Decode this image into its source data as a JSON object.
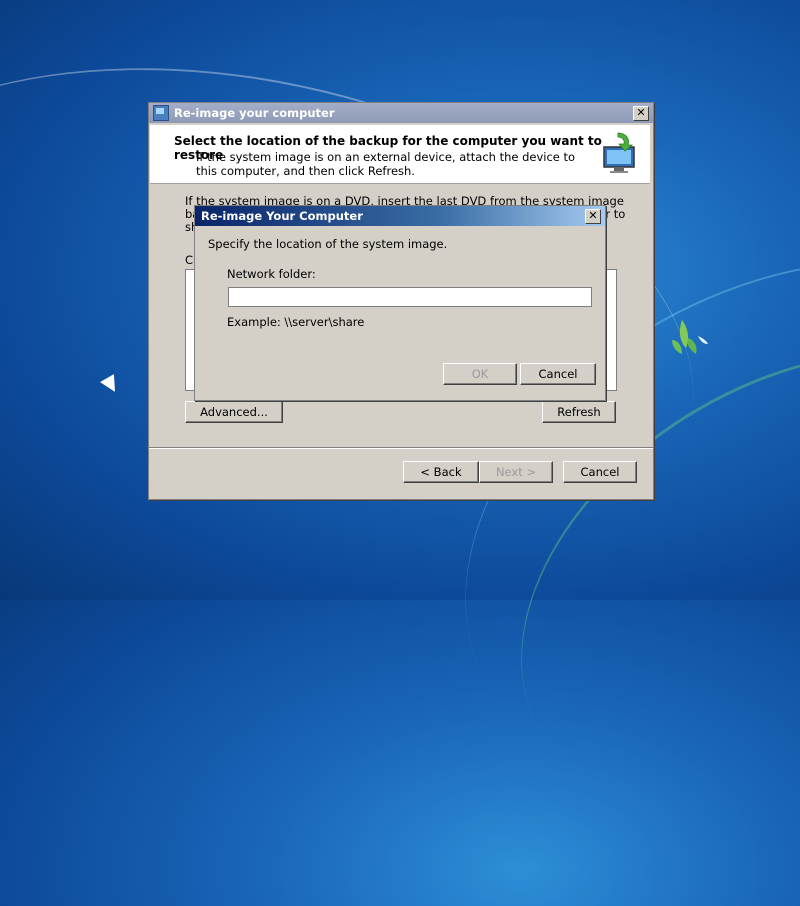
{
  "main_window": {
    "title": "Re-image your computer",
    "header_title": "Select the location of the backup for the computer you want to restore",
    "header_subtitle": "If the system image is on an external device, attach the device to this computer, and then click Refresh.",
    "body_text": "If the system image is on a DVD, insert the last DVD from the system image backup. Click Advanced to add a system image located on the network or to show updated system image information.",
    "current_label": "Cu",
    "advanced_button": "Advanced...",
    "refresh_button": "Refresh",
    "back_button": "< Back",
    "next_button": "Next >",
    "cancel_button": "Cancel"
  },
  "dialog": {
    "title": "Re-image Your Computer",
    "instruction": "Specify the location of the system image.",
    "network_label": "Network folder:",
    "network_value": "",
    "example_text": "Example: \\\\server\\share",
    "ok_button": "OK",
    "cancel_button": "Cancel"
  },
  "icons": {
    "window_icon": "backup-restore-icon",
    "header_icon": "monitor-backup-icon",
    "close": "close-icon"
  }
}
